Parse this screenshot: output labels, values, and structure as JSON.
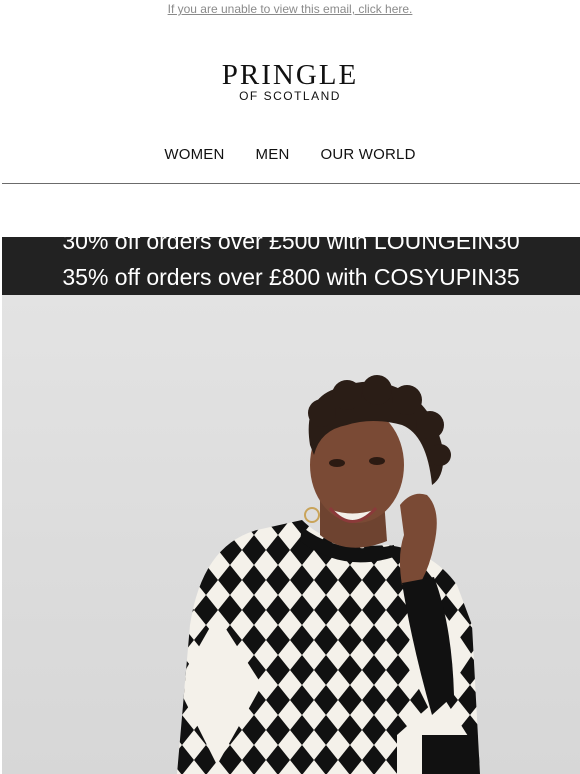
{
  "header": {
    "view_in_browser": "If you are unable to view this email, click here."
  },
  "logo": {
    "main": "PRINGLE",
    "sub": "OF SCOTLAND"
  },
  "nav": {
    "items": [
      {
        "label": "WOMEN"
      },
      {
        "label": "MEN"
      },
      {
        "label": "OUR WORLD"
      }
    ]
  },
  "promo": {
    "line1": "30% off orders over £500 with LOUNGEIN30",
    "line2": "35% off orders over £800 with COSYUPIN35"
  },
  "colors": {
    "promo_bg": "#222222",
    "link_gray": "#8a8a8a"
  }
}
